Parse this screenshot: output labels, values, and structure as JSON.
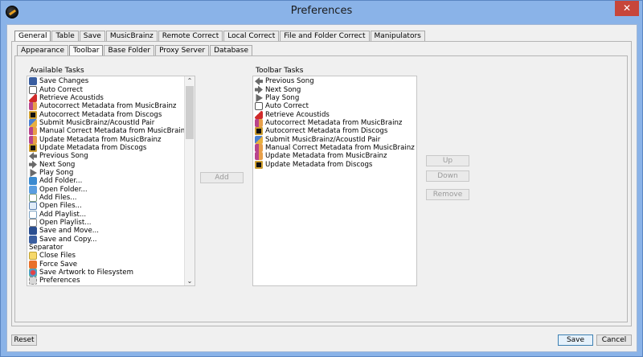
{
  "window": {
    "title": "Preferences",
    "close_glyph": "✕"
  },
  "tabs_top": [
    "General",
    "Table",
    "Save",
    "MusicBrainz",
    "Remote Correct",
    "Local Correct",
    "File and Folder Correct",
    "Manipulators"
  ],
  "tabs_sub": [
    "Appearance",
    "Toolbar",
    "Base Folder",
    "Proxy Server",
    "Database"
  ],
  "available": {
    "label": "Available Tasks",
    "items": [
      {
        "label": "Save Changes",
        "icon": "save-icon"
      },
      {
        "label": "Auto Correct",
        "icon": "autocorrect-icon"
      },
      {
        "label": "Retrieve Acoustids",
        "icon": "acoustid-icon"
      },
      {
        "label": "Autocorrect Metadata from MusicBrainz",
        "icon": "musicbrainz-icon"
      },
      {
        "label": "Autocorrect Metadata from Discogs",
        "icon": "discogs-icon"
      },
      {
        "label": "Submit MusicBrainz/AcoustId Pair",
        "icon": "submit-icon"
      },
      {
        "label": "Manual Correct Metadata from MusicBrainz",
        "icon": "musicbrainz-icon"
      },
      {
        "label": "Update Metadata from MusicBrainz",
        "icon": "musicbrainz-icon"
      },
      {
        "label": "Update Metadata from Discogs",
        "icon": "discogs-icon"
      },
      {
        "label": "Previous Song",
        "icon": "previous-icon"
      },
      {
        "label": "Next Song",
        "icon": "next-icon"
      },
      {
        "label": "Play Song",
        "icon": "play-icon"
      },
      {
        "label": "Add Folder...",
        "icon": "add-folder-icon"
      },
      {
        "label": "Open Folder...",
        "icon": "open-folder-icon"
      },
      {
        "label": "Add Files...",
        "icon": "add-files-icon"
      },
      {
        "label": "Open Files...",
        "icon": "open-files-icon"
      },
      {
        "label": "Add Playlist...",
        "icon": "add-playlist-icon"
      },
      {
        "label": "Open Playlist...",
        "icon": "open-playlist-icon"
      },
      {
        "label": "Save and Move...",
        "icon": "save-move-icon"
      },
      {
        "label": "Save and Copy...",
        "icon": "save-copy-icon"
      },
      {
        "label": "Separator",
        "icon": "none"
      },
      {
        "label": "Close Files",
        "icon": "close-files-icon"
      },
      {
        "label": "Force Save",
        "icon": "force-save-icon"
      },
      {
        "label": "Save Artwork to Filesystem",
        "icon": "artwork-icon"
      },
      {
        "label": "Preferences",
        "icon": "preferences-icon"
      }
    ]
  },
  "toolbar": {
    "label": "Toolbar Tasks",
    "items": [
      {
        "label": "Previous Song",
        "icon": "previous-icon"
      },
      {
        "label": "Next Song",
        "icon": "next-icon"
      },
      {
        "label": "Play Song",
        "icon": "play-icon"
      },
      {
        "label": "Auto Correct",
        "icon": "autocorrect-icon"
      },
      {
        "label": "Retrieve Acoustids",
        "icon": "acoustid-icon"
      },
      {
        "label": "Autocorrect Metadata from MusicBrainz",
        "icon": "musicbrainz-icon"
      },
      {
        "label": "Autocorrect Metadata from Discogs",
        "icon": "discogs-icon"
      },
      {
        "label": "Submit MusicBrainz/AcoustId Pair",
        "icon": "submit-icon"
      },
      {
        "label": "Manual Correct Metadata from MusicBrainz",
        "icon": "musicbrainz-icon"
      },
      {
        "label": "Update Metadata from MusicBrainz",
        "icon": "musicbrainz-icon"
      },
      {
        "label": "Update Metadata from Discogs",
        "icon": "discogs-icon"
      }
    ]
  },
  "buttons": {
    "add": "Add",
    "up": "Up",
    "down": "Down",
    "remove": "Remove",
    "reset": "Reset",
    "save": "Save",
    "cancel": "Cancel"
  },
  "scroll": {
    "up_glyph": "⌃",
    "down_glyph": "⌄"
  }
}
